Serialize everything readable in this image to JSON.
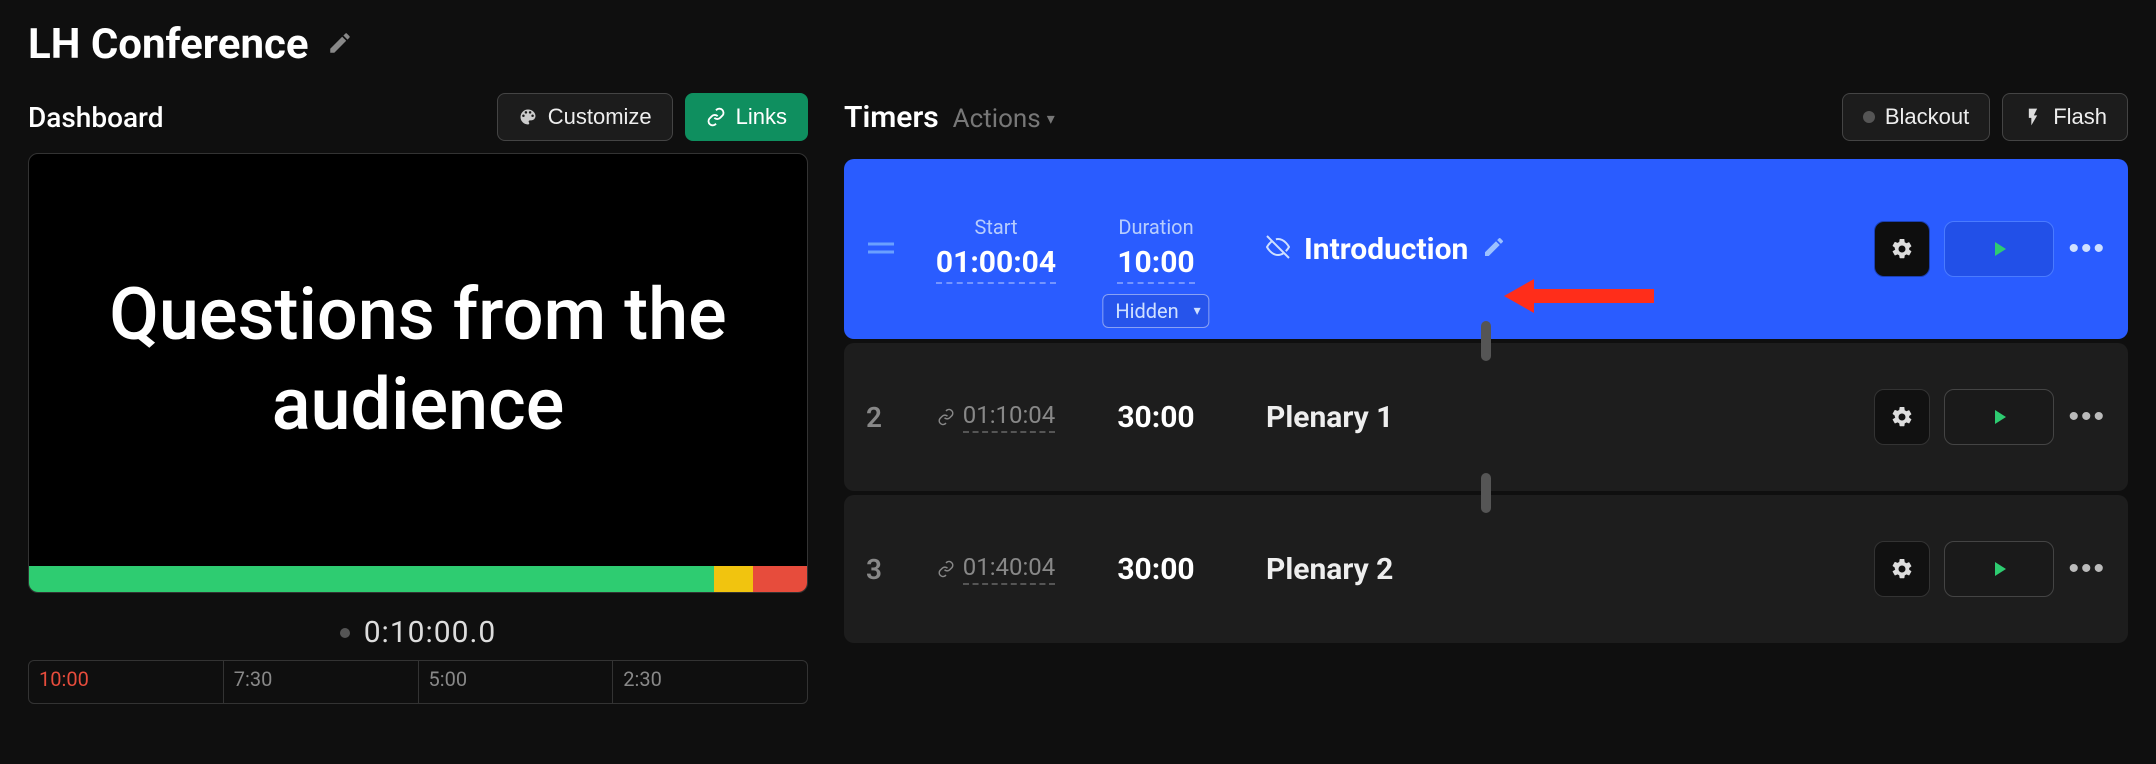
{
  "title": "LH Conference",
  "left": {
    "heading": "Dashboard",
    "customize_label": "Customize",
    "links_label": "Links",
    "preview_text": "Questions from the audience",
    "progress": {
      "green_pct": 88,
      "yellow_pct": 5,
      "red_pct": 7
    },
    "timecode": "0:10:00.0",
    "ruler": [
      "10:00",
      "7:30",
      "5:00",
      "2:30"
    ]
  },
  "right": {
    "heading": "Timers",
    "actions_label": "Actions",
    "blackout_label": "Blackout",
    "flash_label": "Flash"
  },
  "timers": [
    {
      "active": true,
      "start_label": "Start",
      "duration_label": "Duration",
      "start": "01:00:04",
      "duration": "10:00",
      "hidden_dropdown": "Hidden",
      "name": "Introduction",
      "linked": false
    },
    {
      "index": "2",
      "start": "01:10:04",
      "duration": "30:00",
      "name": "Plenary 1",
      "linked": true
    },
    {
      "index": "3",
      "start": "01:40:04",
      "duration": "30:00",
      "name": "Plenary 2",
      "linked": true
    }
  ]
}
